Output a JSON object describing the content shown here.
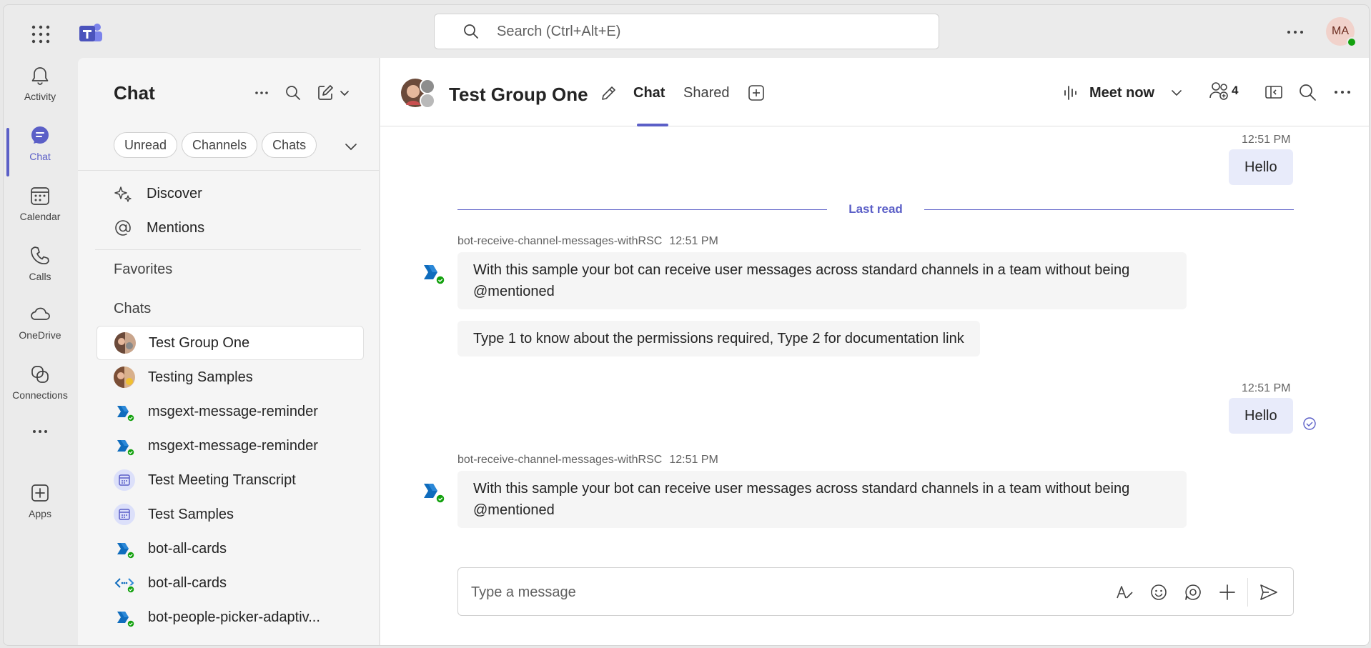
{
  "app": {
    "name": "Microsoft Teams"
  },
  "topbar": {
    "search_placeholder": "Search (Ctrl+Alt+E)",
    "user_initials": "MA"
  },
  "rail": {
    "items": [
      {
        "label": "Activity",
        "icon": "bell-icon"
      },
      {
        "label": "Chat",
        "icon": "chat-icon",
        "active": true
      },
      {
        "label": "Calendar",
        "icon": "calendar-icon"
      },
      {
        "label": "Calls",
        "icon": "phone-icon"
      },
      {
        "label": "OneDrive",
        "icon": "cloud-icon"
      },
      {
        "label": "Connections",
        "icon": "connections-icon"
      },
      {
        "label": "",
        "icon": "more-horizontal-icon"
      },
      {
        "label": "Apps",
        "icon": "add-app-icon"
      }
    ]
  },
  "chatlist": {
    "title": "Chat",
    "filters": [
      "Unread",
      "Channels",
      "Chats"
    ],
    "nav": [
      {
        "label": "Discover",
        "icon": "sparkle-icon"
      },
      {
        "label": "Mentions",
        "icon": "at-icon"
      }
    ],
    "favorites_label": "Favorites",
    "chats_label": "Chats",
    "chats": [
      {
        "name": "Test Group One",
        "type": "group",
        "selected": true
      },
      {
        "name": "Testing Samples",
        "type": "group"
      },
      {
        "name": "msgext-message-reminder",
        "type": "bot"
      },
      {
        "name": "msgext-message-reminder",
        "type": "bot"
      },
      {
        "name": "Test Meeting Transcript",
        "type": "meeting"
      },
      {
        "name": "Test Samples",
        "type": "meeting"
      },
      {
        "name": "bot-all-cards",
        "type": "bot"
      },
      {
        "name": "bot-all-cards",
        "type": "bot-code"
      },
      {
        "name": "bot-people-picker-adaptiv...",
        "type": "bot"
      }
    ]
  },
  "conversation": {
    "title": "Test Group One",
    "tabs": [
      "Chat",
      "Shared"
    ],
    "active_tab": "Chat",
    "meet_now_label": "Meet now",
    "participant_count": "4",
    "last_read_label": "Last read",
    "messages": [
      {
        "from": "me",
        "time": "12:51 PM",
        "text": "Hello"
      },
      {
        "from": "bot-receive-channel-messages-withRSC",
        "time": "12:51 PM",
        "text": "With this sample your bot can receive user messages across standard channels in a team without being @mentioned",
        "text2": "Type 1 to know about the permissions required, Type 2 for documentation link"
      },
      {
        "from": "me",
        "time": "12:51 PM",
        "text": "Hello"
      },
      {
        "from": "bot-receive-channel-messages-withRSC",
        "time": "12:51 PM",
        "text": "With this sample your bot can receive user messages across standard channels in a team without being @mentioned"
      }
    ],
    "compose_placeholder": "Type a message"
  },
  "colors": {
    "accent": "#5b5fc7",
    "presence_available": "#13a10e",
    "bubble_me": "#e8ebfa",
    "bubble_other": "#f5f5f5"
  }
}
